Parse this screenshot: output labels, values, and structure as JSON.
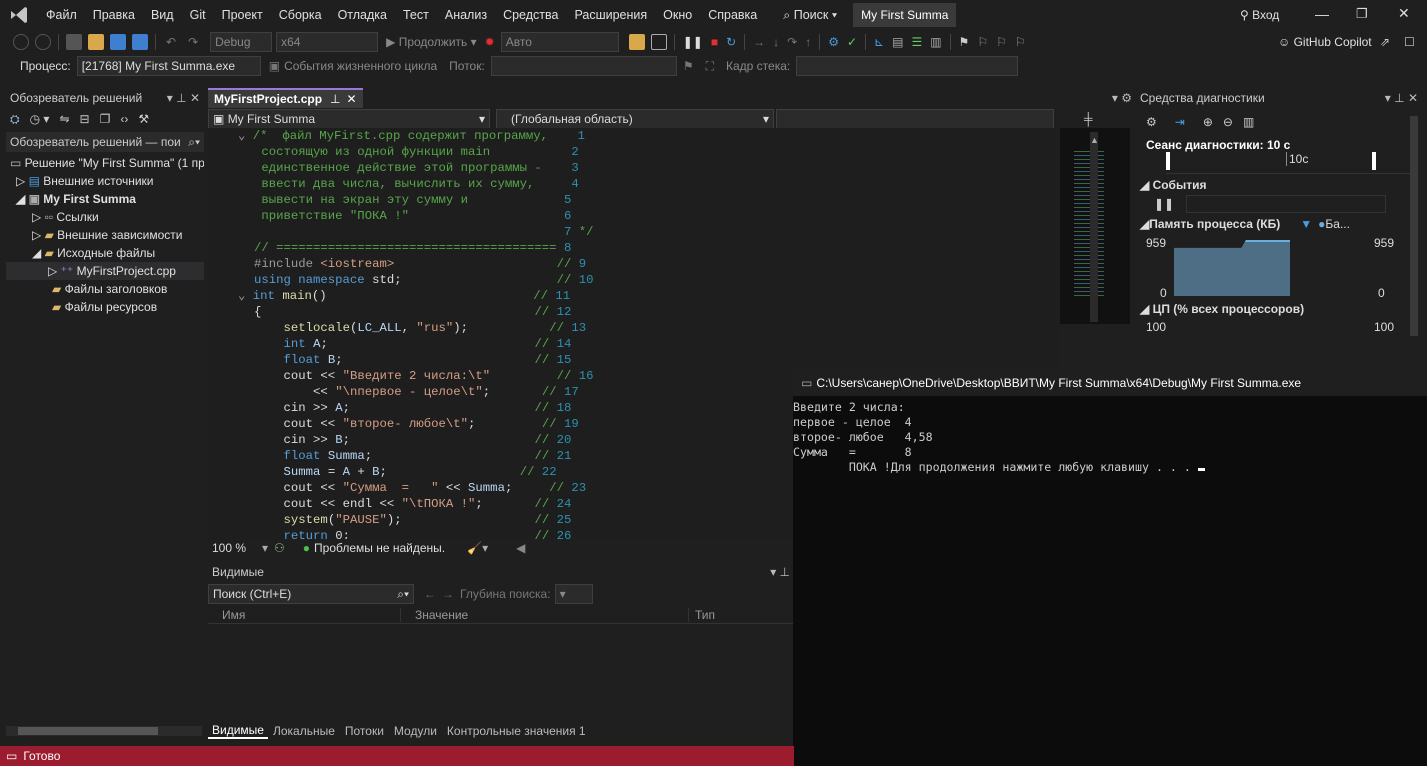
{
  "menu": [
    "Файл",
    "Правка",
    "Вид",
    "Git",
    "Проект",
    "Сборка",
    "Отладка",
    "Тест",
    "Анализ",
    "Средства",
    "Расширения",
    "Окно",
    "Справка"
  ],
  "search_label": "Поиск",
  "solution_name": "My First Summa",
  "login": "Вход",
  "copilot": "GitHub Copilot",
  "toolbar": {
    "config": "Debug",
    "platform": "x64",
    "continue": "Продолжить",
    "auto": "Авто"
  },
  "process_bar": {
    "process_label": "Процесс:",
    "process_value": "[21768] My First Summa.exe",
    "lifecycle": "События жизненного цикла",
    "thread_label": "Поток:",
    "stack_label": "Кадр стека:"
  },
  "solution_explorer": {
    "title": "Обозреватель решений",
    "search": "Обозреватель решений — пои",
    "items": [
      {
        "label": "Решение \"My First Summa\"  (1 пр",
        "indent": 0
      },
      {
        "label": "Внешние источники",
        "indent": 1
      },
      {
        "label": "My First Summa",
        "indent": 1
      },
      {
        "label": "Ссылки",
        "indent": 2
      },
      {
        "label": "Внешние зависимости",
        "indent": 2
      },
      {
        "label": "Исходные файлы",
        "indent": 2
      },
      {
        "label": "MyFirstProject.cpp",
        "indent": 3
      },
      {
        "label": "Файлы заголовков",
        "indent": 2
      },
      {
        "label": "Файлы ресурсов",
        "indent": 2
      }
    ]
  },
  "editor": {
    "tab": "MyFirstProject.cpp",
    "scope_project": "My First Summa",
    "scope_global": "(Глобальная область)",
    "zoom": "100 %",
    "issues": "Проблемы не найдены."
  },
  "diagnostics": {
    "title": "Средства диагностики",
    "session": "Сеанс диагностики: 10 с",
    "tick": "10с",
    "events": "События",
    "memory": "Память процесса (КБ)",
    "memory_legend": "Ба...",
    "mem_max": "959",
    "mem_min": "0",
    "cpu": "ЦП (% всех процессоров)",
    "cpu_max": "100"
  },
  "console": {
    "title": "C:\\Users\\санер\\OneDrive\\Desktop\\ВВИТ\\My First Summa\\x64\\Debug\\My First Summa.exe",
    "lines": [
      "Введите 2 числа:",
      "первое - целое  4",
      "второе- любое   4,58",
      "Сумма   =       8",
      "        ПОКА !Для продолжения нажмите любую клавишу . . . "
    ]
  },
  "watch": {
    "title": "Видимые",
    "search": "Поиск (Ctrl+E)",
    "depth": "Глубина поиска:",
    "cols": [
      "Имя",
      "Значение",
      "Тип"
    ],
    "tabs": [
      "Видимые",
      "Локальные",
      "Потоки",
      "Модули",
      "Контрольные значения 1"
    ]
  },
  "status": "Готово"
}
